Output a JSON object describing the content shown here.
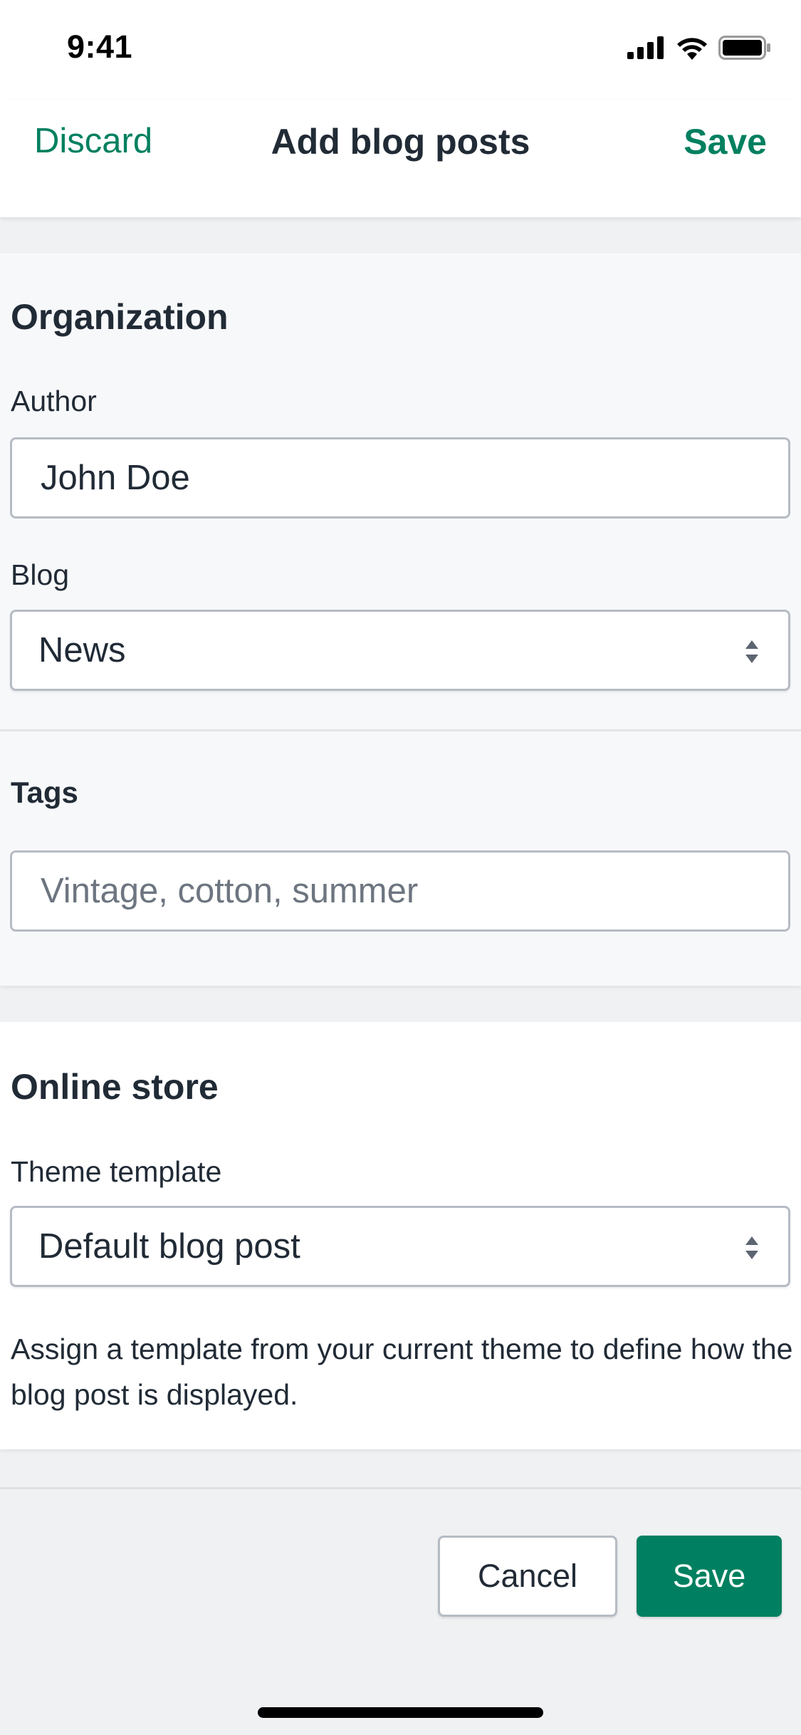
{
  "status_bar": {
    "time": "9:41",
    "icons": [
      "signal-icon",
      "wifi-icon",
      "battery-icon"
    ]
  },
  "nav": {
    "discard_label": "Discard",
    "title": "Add blog posts",
    "save_label": "Save"
  },
  "organization": {
    "title": "Organization",
    "author_label": "Author",
    "author_value": "John Doe",
    "blog_label": "Blog",
    "blog_value": "News"
  },
  "tags": {
    "title": "Tags",
    "placeholder": "Vintage, cotton, summer"
  },
  "online_store": {
    "title": "Online store",
    "template_label": "Theme template",
    "template_value": "Default blog post",
    "help_text": "Assign a template from your current theme to define how the blog post is displayed."
  },
  "footer": {
    "cancel_label": "Cancel",
    "save_label": "Save"
  },
  "colors": {
    "accent": "#008060",
    "text": "#212b36",
    "placeholder": "#6d7580"
  }
}
